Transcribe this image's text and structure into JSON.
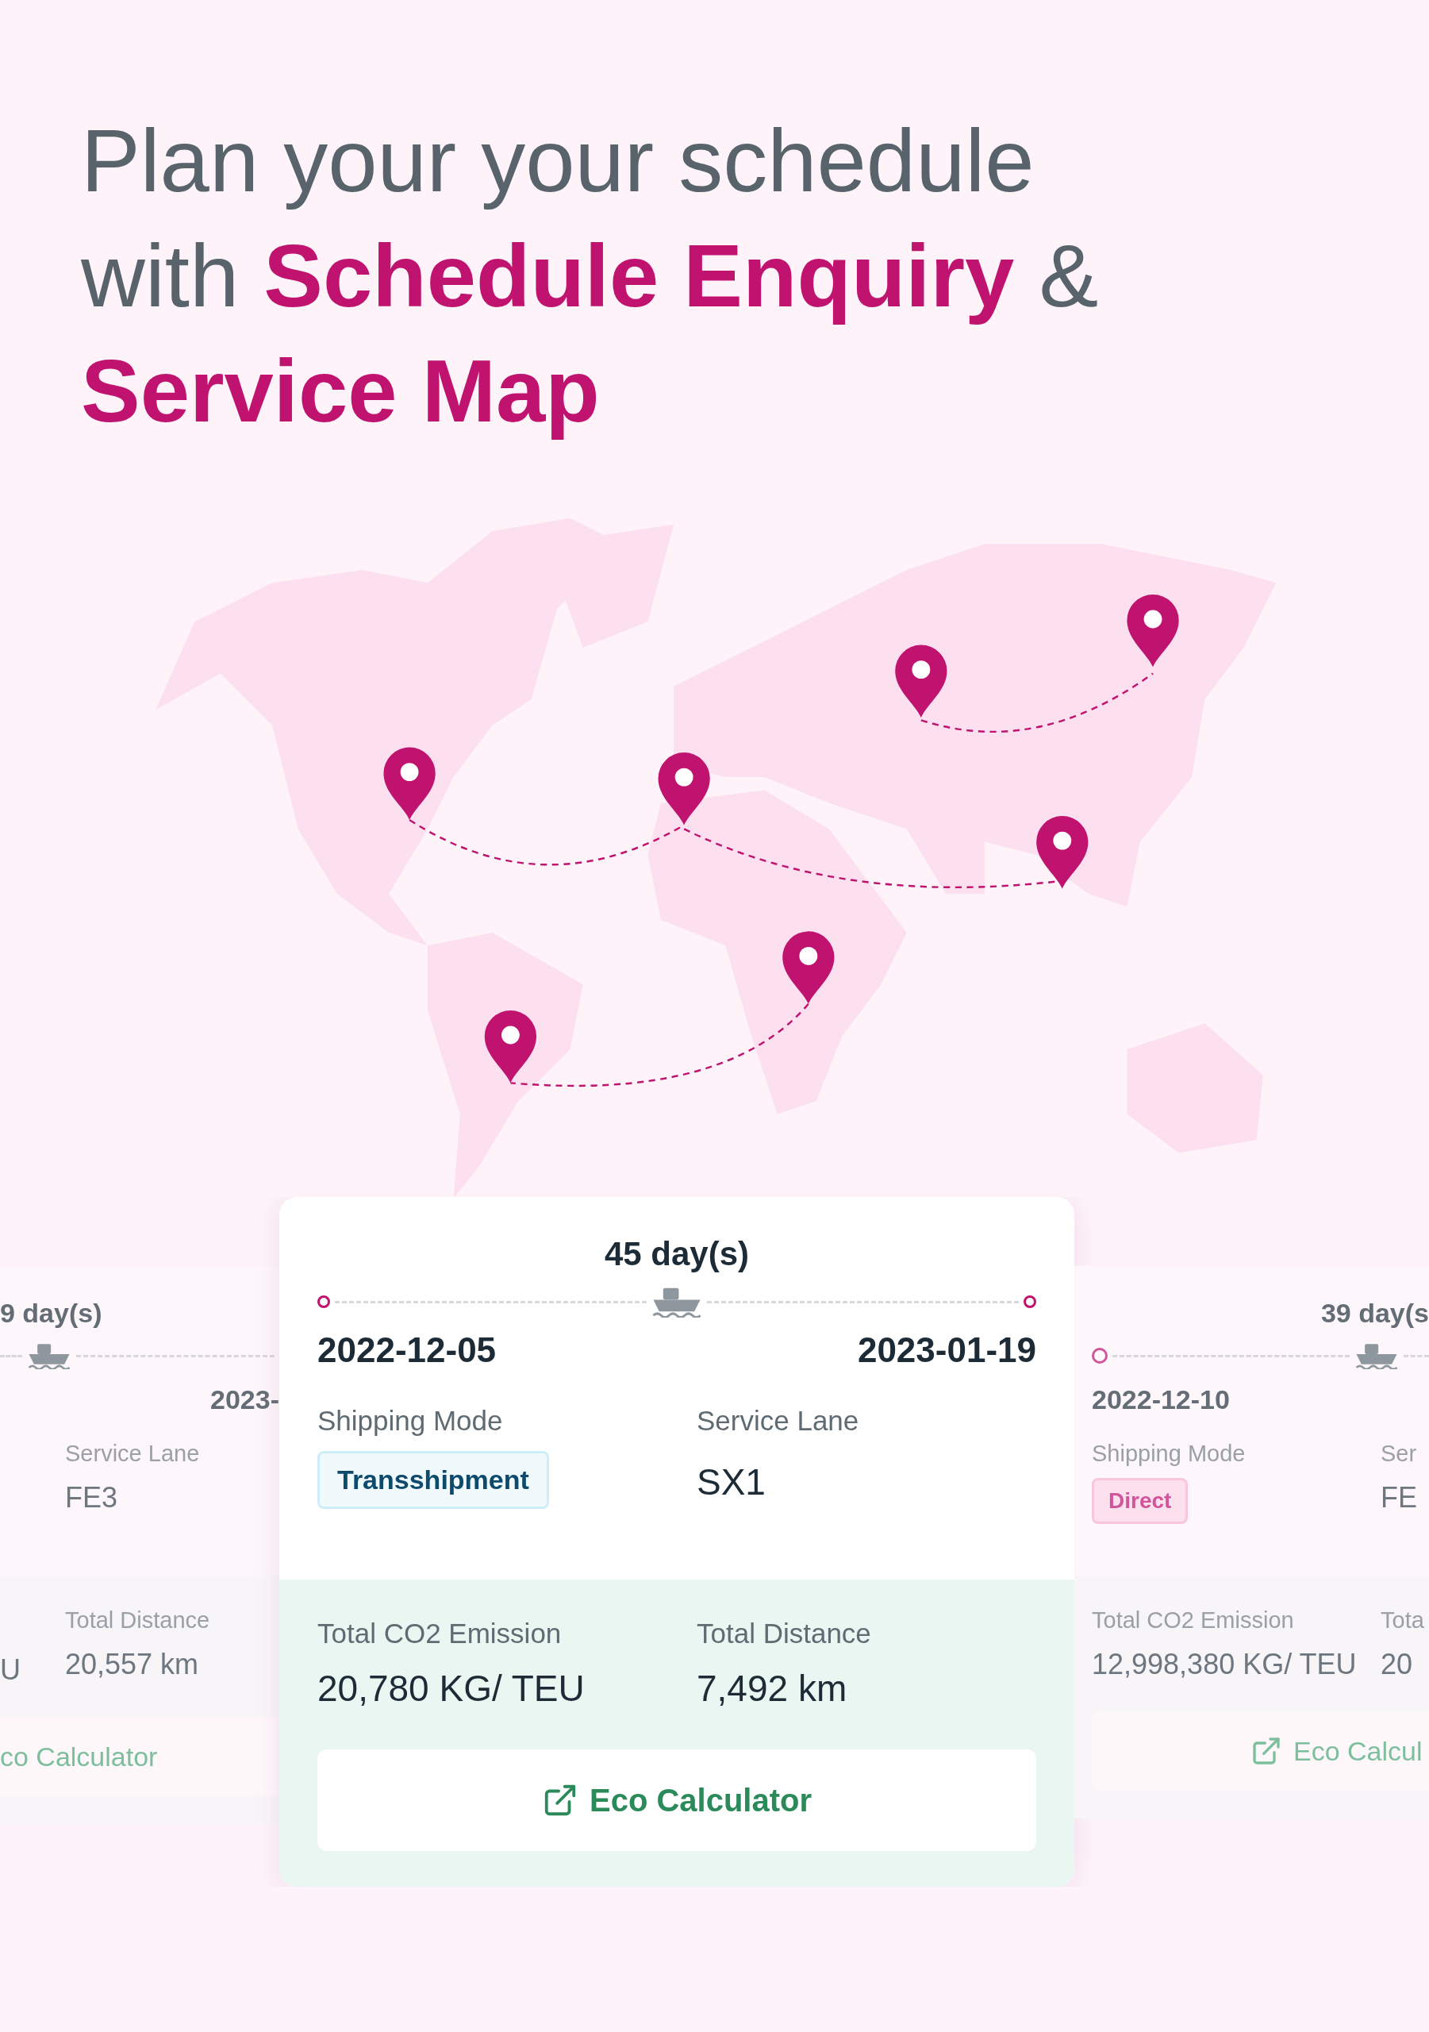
{
  "headline": {
    "lines": [
      "Plan your your schedule",
      "with **Schedule Enquiry** &",
      "**Service Map**"
    ]
  },
  "cards": [
    {
      "kind": "left",
      "duration": "9 day(s)",
      "start_dot": false,
      "end_dot": false,
      "arrive_date": "2023-",
      "service_lane": {
        "label": "Service Lane",
        "value": "FE3"
      },
      "co2": {
        "value": "U"
      },
      "distance": {
        "label": "Total Distance",
        "value": "20,557 km"
      },
      "button": {
        "label": "co Calculator",
        "icon": false
      }
    },
    {
      "kind": "main",
      "duration": "45 day(s)",
      "start_dot": true,
      "end_dot": true,
      "depart_date": "2022-12-05",
      "arrive_date": "2023-01-19",
      "shipping_mode": {
        "label": "Shipping Mode",
        "value": "Transshipment",
        "kind": "transshipment"
      },
      "service_lane": {
        "label": "Service Lane",
        "value": "SX1"
      },
      "co2": {
        "label": "Total CO2 Emission",
        "value": "20,780 KG/ TEU"
      },
      "distance": {
        "label": "Total Distance",
        "value": "7,492 km"
      },
      "button": {
        "label": "Eco Calculator",
        "icon": true
      }
    },
    {
      "kind": "right",
      "duration": "39 day(s",
      "start_dot": true,
      "end_dot": false,
      "depart_date": "2022-12-10",
      "shipping_mode": {
        "label": "Shipping Mode",
        "value": "Direct",
        "kind": "direct"
      },
      "service_lane": {
        "label": "Ser",
        "value": "FE"
      },
      "co2": {
        "label": "Total CO2 Emission",
        "value": "12,998,380 KG/ TEU"
      },
      "distance": {
        "label": "Tota",
        "value": "20"
      },
      "button": {
        "label": "Eco Calcul",
        "icon": true
      }
    }
  ]
}
